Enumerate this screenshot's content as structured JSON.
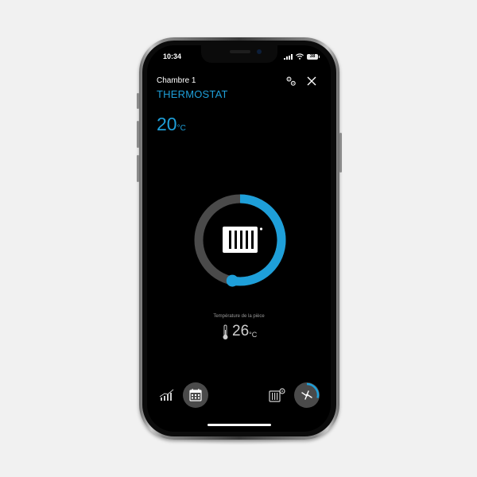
{
  "status_bar": {
    "time": "10:34",
    "battery": "38"
  },
  "header": {
    "room": "Chambre 1",
    "title": "THERMOSTAT"
  },
  "setpoint": {
    "value": "20",
    "unit": "°C"
  },
  "dial": {
    "mode_icon": "radiator-icon",
    "fill_fraction": 0.53
  },
  "room_temperature": {
    "label": "Température de la pièce",
    "value": "26",
    "unit": "°C"
  },
  "bottom_nav": {
    "left": [
      "history-chart-icon",
      "calendar-icon"
    ],
    "right": [
      "radiator-settings-icon",
      "fan-mode-icon"
    ]
  },
  "colors": {
    "accent": "#1e9fd9",
    "track": "#4a4a4a",
    "background": "#000000"
  }
}
